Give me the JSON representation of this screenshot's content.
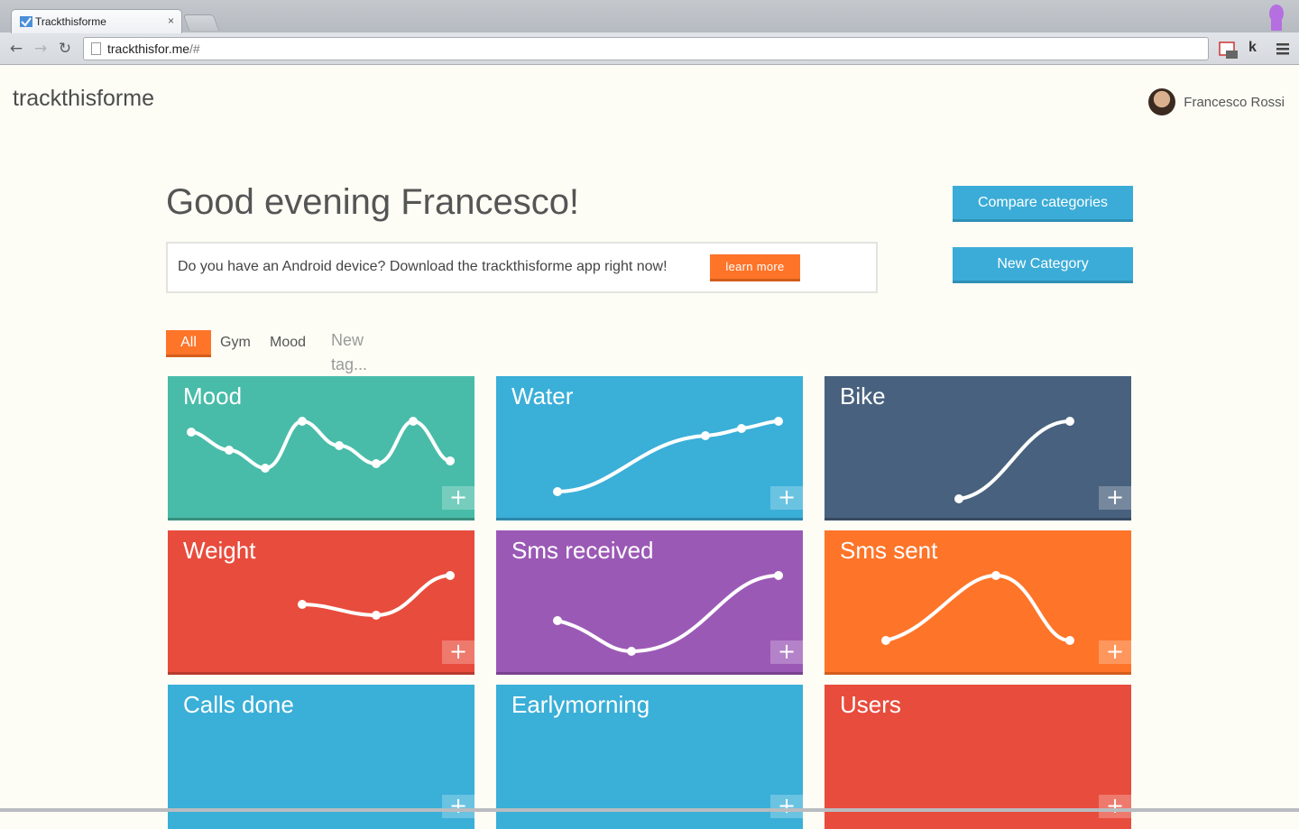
{
  "browser": {
    "tab_title": "Trackthisforme",
    "close_glyph": "×",
    "url_host": "trackthisfor.me",
    "url_rest": "/#",
    "ext_k": "k"
  },
  "header": {
    "brand": "trackthisforme",
    "user_name": "Francesco Rossi"
  },
  "main": {
    "greeting": "Good evening Francesco!",
    "compare_label": "Compare categories",
    "new_category_label": "New Category",
    "promo_text": "Do you have an Android device? Download the trackthisforme app right now!",
    "learn_more_label": "learn more"
  },
  "tags": {
    "all": "All",
    "gym": "Gym",
    "mood": "Mood",
    "new_placeholder": "New tag..."
  },
  "cards": [
    {
      "name": "Mood",
      "color": "#48bca9"
    },
    {
      "name": "Water",
      "color": "#3aafd8"
    },
    {
      "name": "Bike",
      "color": "#48617e"
    },
    {
      "name": "Weight",
      "color": "#e84c3d"
    },
    {
      "name": "Sms received",
      "color": "#9b59b6"
    },
    {
      "name": "Sms sent",
      "color": "#fe7429"
    },
    {
      "name": "Calls done",
      "color": "#3aafd8"
    },
    {
      "name": "Earlymorning",
      "color": "#3aafd8"
    },
    {
      "name": "Users",
      "color": "#e84c3d"
    }
  ],
  "add_glyph": "+",
  "colors": {
    "accent_orange": "#fe7429",
    "accent_blue": "#3bacd7"
  }
}
